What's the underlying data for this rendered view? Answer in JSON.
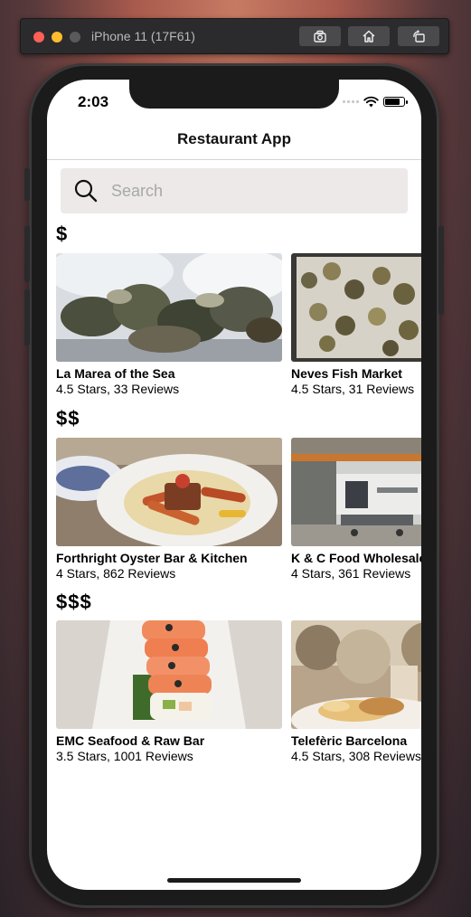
{
  "simulator": {
    "title": "iPhone 11 (17F61)"
  },
  "status": {
    "time": "2:03",
    "battery_level": 0.85
  },
  "nav": {
    "title": "Restaurant App"
  },
  "search": {
    "placeholder": "Search"
  },
  "sections": [
    {
      "label": "$",
      "items": [
        {
          "name": "La Marea of the Sea",
          "meta": "4.5 Stars, 33 Reviews"
        },
        {
          "name": "Neves Fish Market",
          "meta": "4.5 Stars, 31 Reviews"
        }
      ]
    },
    {
      "label": "$$",
      "items": [
        {
          "name": "Forthright Oyster Bar & Kitchen",
          "meta": "4 Stars, 862 Reviews"
        },
        {
          "name": "K & C Food Wholesale",
          "meta": "4 Stars, 361 Reviews"
        }
      ]
    },
    {
      "label": "$$$",
      "items": [
        {
          "name": "EMC Seafood & Raw Bar",
          "meta": "3.5 Stars, 1001 Reviews"
        },
        {
          "name": "Telefèric Barcelona",
          "meta": "4.5 Stars, 308 Reviews"
        }
      ]
    }
  ],
  "icons": {
    "search": "search-icon",
    "wifi": "wifi-icon",
    "battery": "battery-icon",
    "screenshot": "camera-icon",
    "home": "home-icon",
    "rotate": "rotate-icon"
  }
}
